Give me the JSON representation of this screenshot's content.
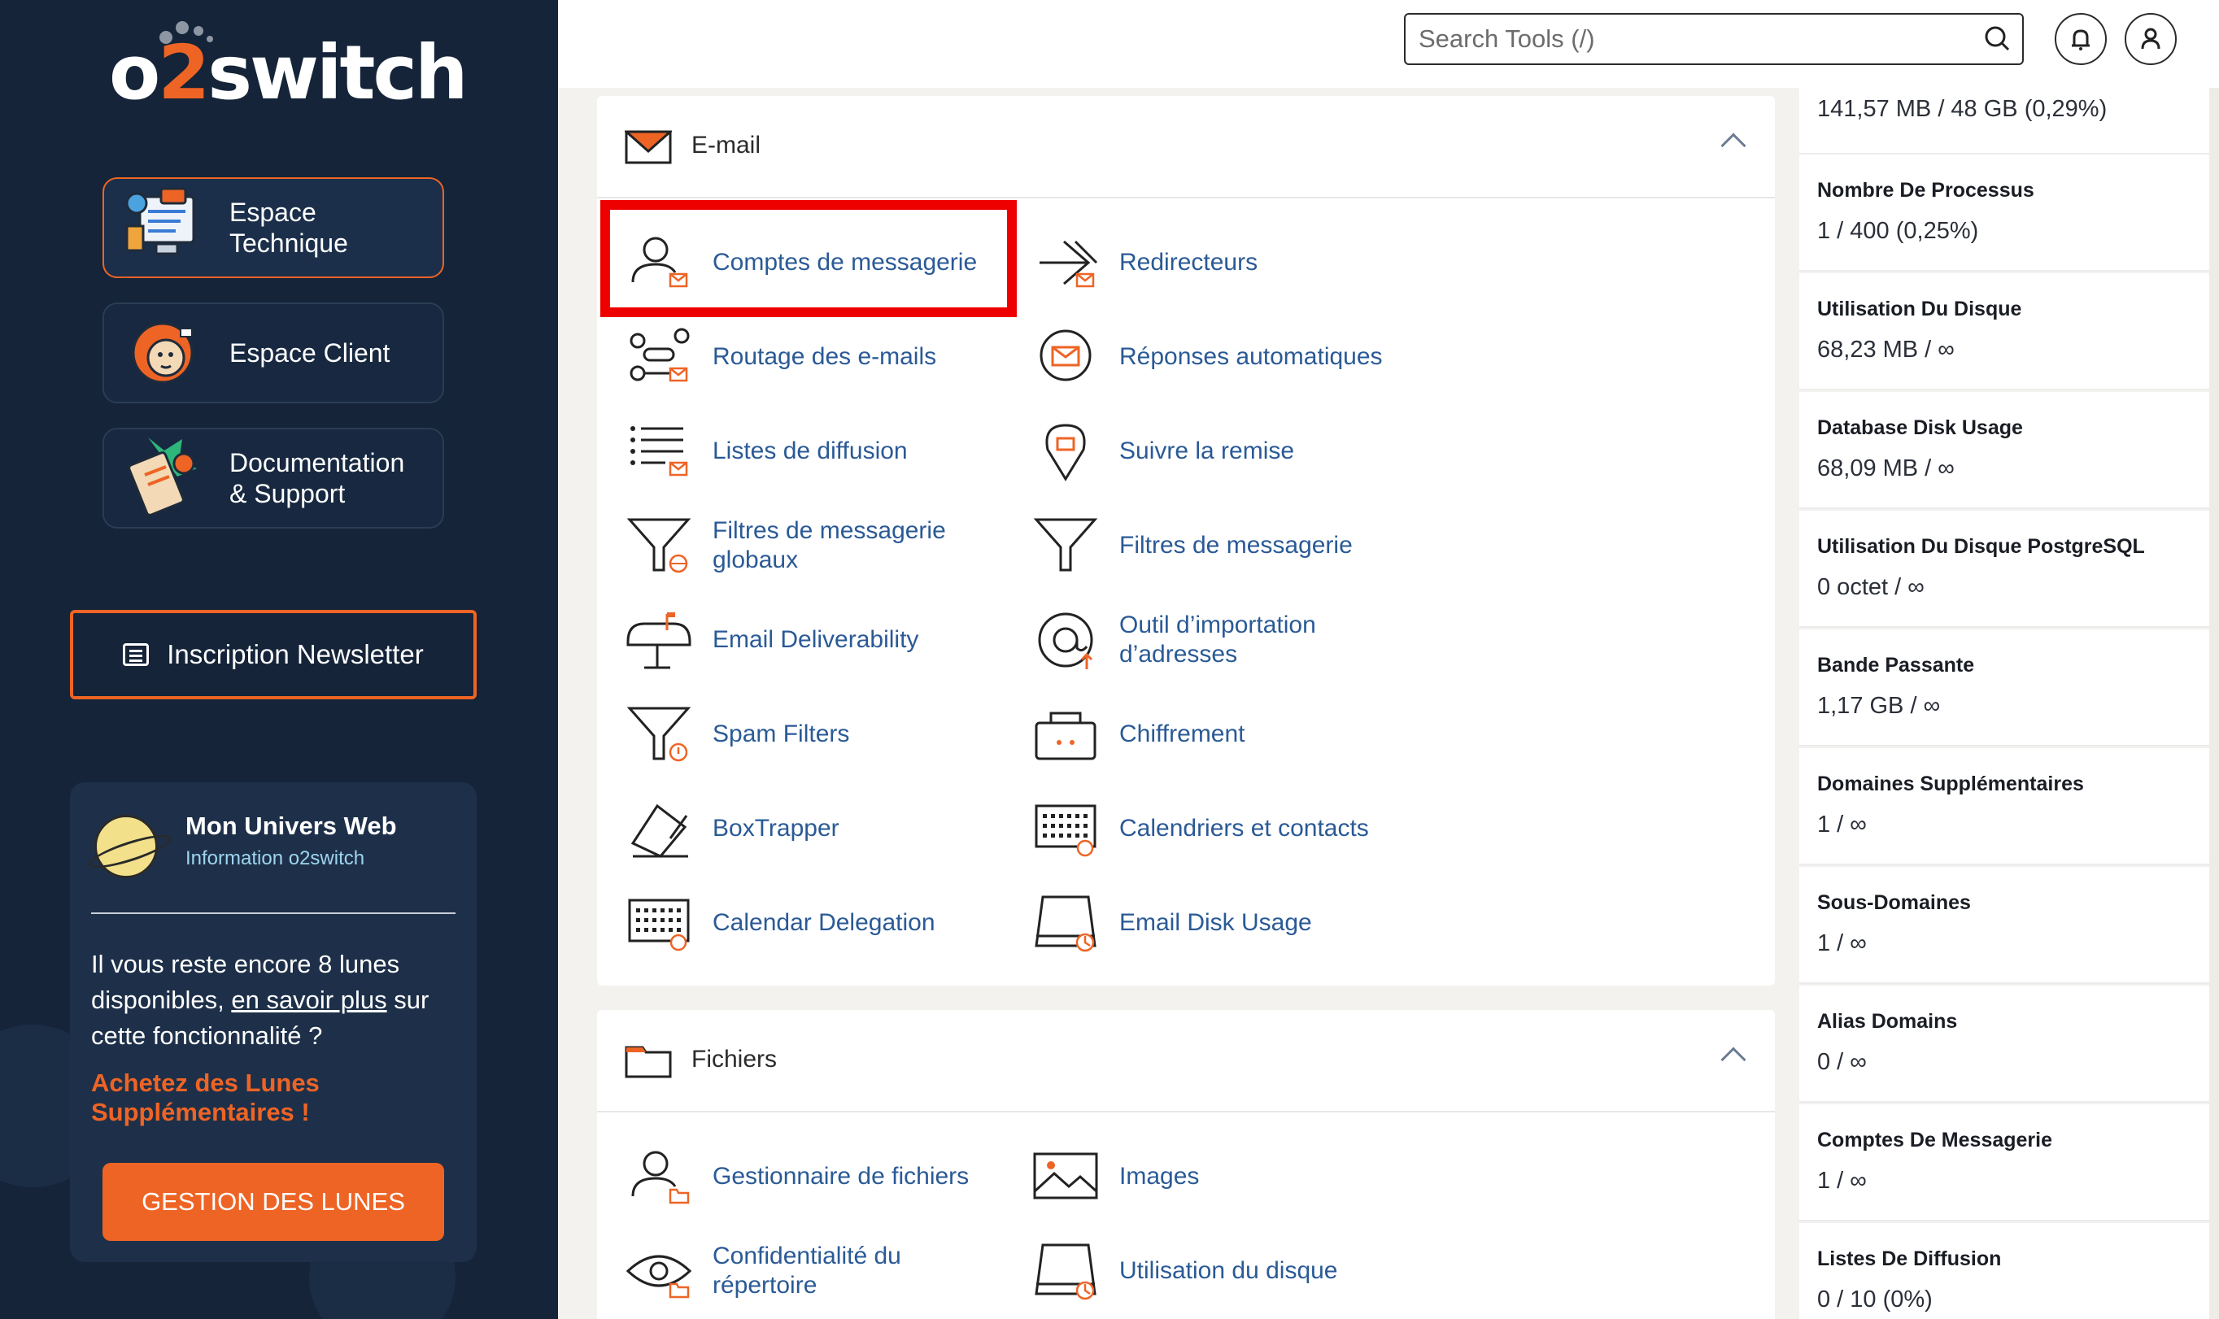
{
  "sidebar": {
    "logo": {
      "prefix": "o",
      "accent": "2",
      "suffix": "switch"
    },
    "nav": [
      {
        "label": "Espace\nTechnique",
        "active": true,
        "icon": "technical-screen-icon"
      },
      {
        "label": "Espace Client",
        "active": false,
        "icon": "lion-icon"
      },
      {
        "label": "Documentation\n& Support",
        "active": false,
        "icon": "clipboard-icon"
      }
    ],
    "newsletter_label": "Inscription Newsletter",
    "univers": {
      "title": "Mon Univers Web",
      "subtitle": "Information o2switch",
      "text_before": "Il vous reste encore 8 lunes disponibles, ",
      "link": "en savoir plus",
      "text_after": " sur cette fonctionnalité ?",
      "cta": "Achetez des Lunes Supplémentaires !",
      "button": "GESTION DES LUNES"
    }
  },
  "header": {
    "search_placeholder": "Search Tools (/)"
  },
  "email_section": {
    "title": "E-mail",
    "tools": [
      {
        "label": "Comptes de messagerie",
        "icon": "user-mail-icon"
      },
      {
        "label": "Redirecteurs",
        "icon": "forward-mail-icon"
      },
      {
        "label": "Routage des e-mails",
        "icon": "routing-icon"
      },
      {
        "label": "Réponses automatiques",
        "icon": "autoresponder-icon"
      },
      {
        "label": "Listes de diffusion",
        "icon": "mailing-list-icon"
      },
      {
        "label": "Suivre la remise",
        "icon": "track-delivery-icon"
      },
      {
        "label": "Filtres de messagerie globaux",
        "icon": "global-filter-icon"
      },
      {
        "label": "Filtres de messagerie",
        "icon": "filter-icon"
      },
      {
        "label": "Email Deliverability",
        "icon": "mailbox-icon"
      },
      {
        "label": "Outil d’importation d’adresses",
        "icon": "address-import-icon"
      },
      {
        "label": "Spam Filters",
        "icon": "spam-filter-icon"
      },
      {
        "label": "Chiffrement",
        "icon": "encryption-icon"
      },
      {
        "label": "BoxTrapper",
        "icon": "boxtrapper-icon"
      },
      {
        "label": "Calendriers et contacts",
        "icon": "calendar-contacts-icon"
      },
      {
        "label": "Calendar Delegation",
        "icon": "calendar-delegation-icon"
      },
      {
        "label": "Email Disk Usage",
        "icon": "email-disk-icon"
      }
    ]
  },
  "files_section": {
    "title": "Fichiers",
    "tools": [
      {
        "label": "Gestionnaire de fichiers",
        "icon": "file-manager-icon"
      },
      {
        "label": "Images",
        "icon": "images-icon"
      },
      {
        "label": "Confidentialité du répertoire",
        "icon": "directory-privacy-icon"
      },
      {
        "label": "Utilisation du disque",
        "icon": "disk-usage-icon"
      }
    ]
  },
  "stats": [
    {
      "label": "",
      "value": "141,57 MB / 48 GB   (0,29%)"
    },
    {
      "label": "Nombre De Processus",
      "value": "1 / 400   (0,25%)"
    },
    {
      "label": "Utilisation Du Disque",
      "value": "68,23 MB / ∞"
    },
    {
      "label": "Database Disk Usage",
      "value": "68,09 MB / ∞"
    },
    {
      "label": "Utilisation Du Disque PostgreSQL",
      "value": "0 octet / ∞"
    },
    {
      "label": "Bande Passante",
      "value": "1,17 GB / ∞"
    },
    {
      "label": "Domaines Supplémentaires",
      "value": "1 / ∞"
    },
    {
      "label": "Sous-Domaines",
      "value": "1 / ∞"
    },
    {
      "label": "Alias Domains",
      "value": "0 / ∞"
    },
    {
      "label": "Comptes De Messagerie",
      "value": "1 / ∞"
    },
    {
      "label": "Listes De Diffusion",
      "value": "0 / 10   (0%)"
    }
  ],
  "colors": {
    "accent": "#ee6425",
    "sidebar": "#152438",
    "link": "#2a5a96",
    "highlight": "#ee0000"
  }
}
